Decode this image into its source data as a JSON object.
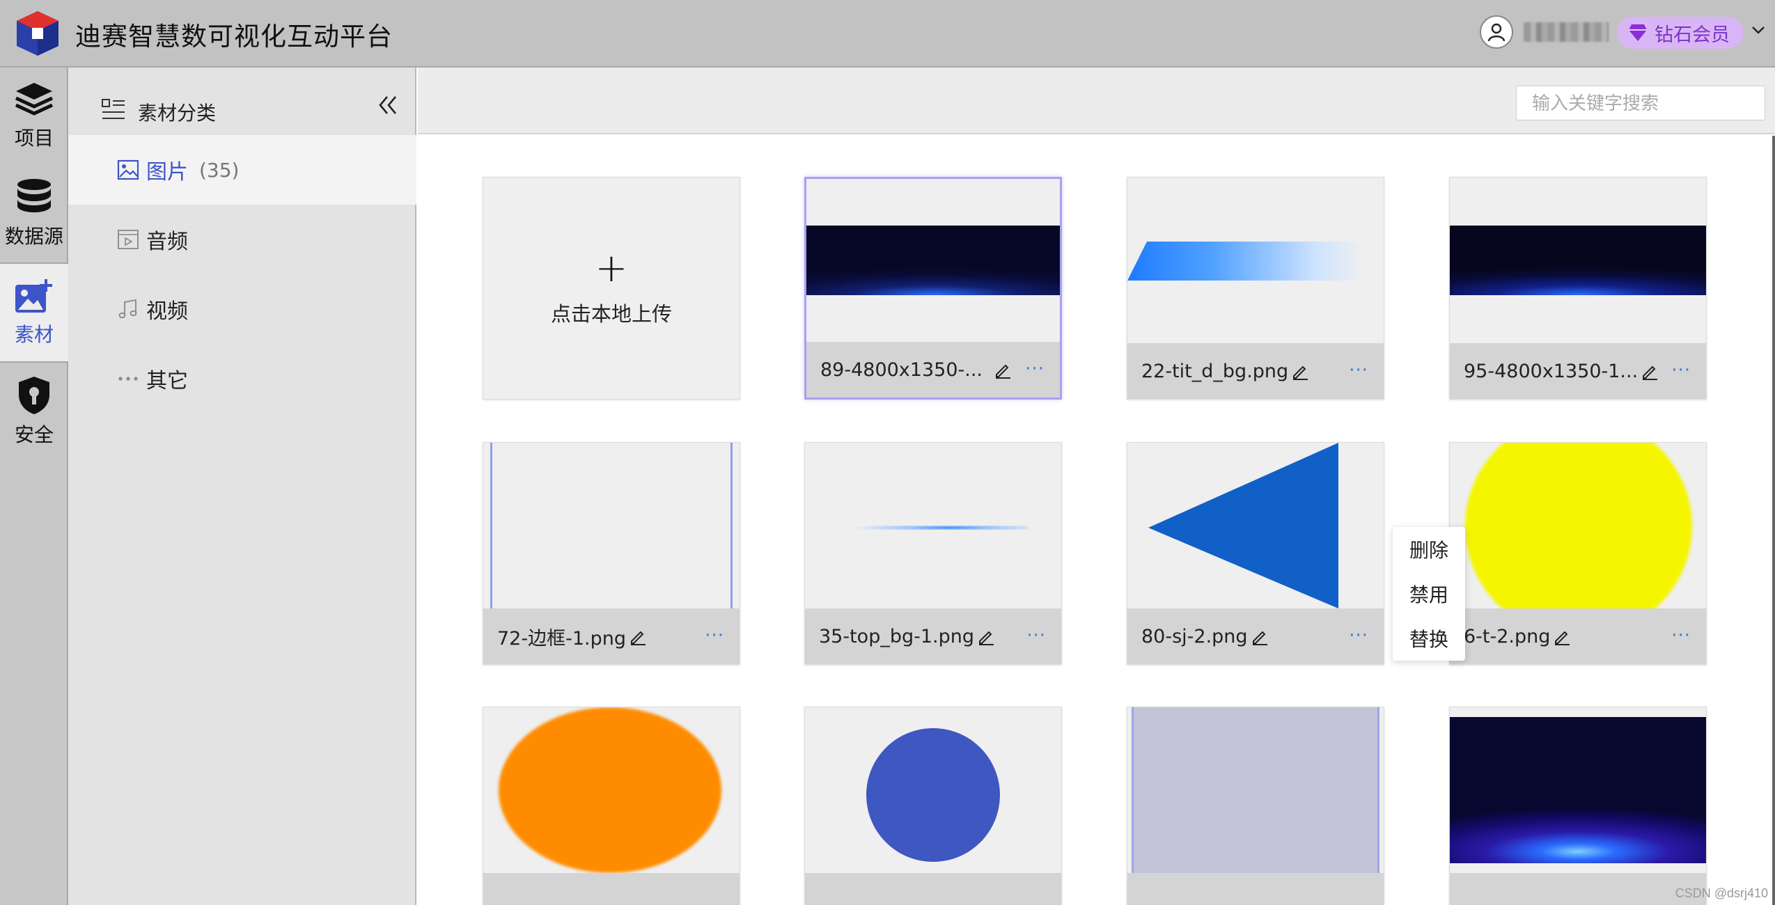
{
  "header": {
    "title": "迪赛智慧数可视化互动平台",
    "vip_label": "钻石会员"
  },
  "rail": {
    "items": [
      {
        "label": "项目",
        "icon": "layers-icon"
      },
      {
        "label": "数据源",
        "icon": "database-icon"
      },
      {
        "label": "素材",
        "icon": "image-add-icon",
        "active": true
      },
      {
        "label": "安全",
        "icon": "shield-lock-icon"
      }
    ]
  },
  "categories": {
    "title": "素材分类",
    "items": [
      {
        "label": "图片",
        "count": "(35)",
        "icon": "image-icon",
        "active": true
      },
      {
        "label": "音频",
        "icon": "audio-icon"
      },
      {
        "label": "视频",
        "icon": "music-note-icon"
      },
      {
        "label": "其它",
        "icon": "more-dots-icon"
      }
    ]
  },
  "search": {
    "placeholder": "输入关键字搜索"
  },
  "upload": {
    "label": "点击本地上传"
  },
  "assets": [
    {
      "name": "89-4800x1350-...",
      "more": "···"
    },
    {
      "name": "22-tit_d_bg.png",
      "more": "···"
    },
    {
      "name": "95-4800x1350-1...",
      "more": "···"
    },
    {
      "name": "72-边框-1.png",
      "more": "···"
    },
    {
      "name": "35-top_bg-1.png",
      "more": "···"
    },
    {
      "name": "80-sj-2.png",
      "more": "···"
    },
    {
      "name": "6-t-2.png",
      "more": "···"
    }
  ],
  "context_menu": {
    "items": [
      "删除",
      "禁用",
      "替换"
    ]
  },
  "watermark": "CSDN @dsrj410",
  "colors": {
    "accent": "#3d55c8",
    "header_bg": "#c2c2c2",
    "vip_bg": "#d8b6f5",
    "vip_text": "#7b32c9"
  }
}
